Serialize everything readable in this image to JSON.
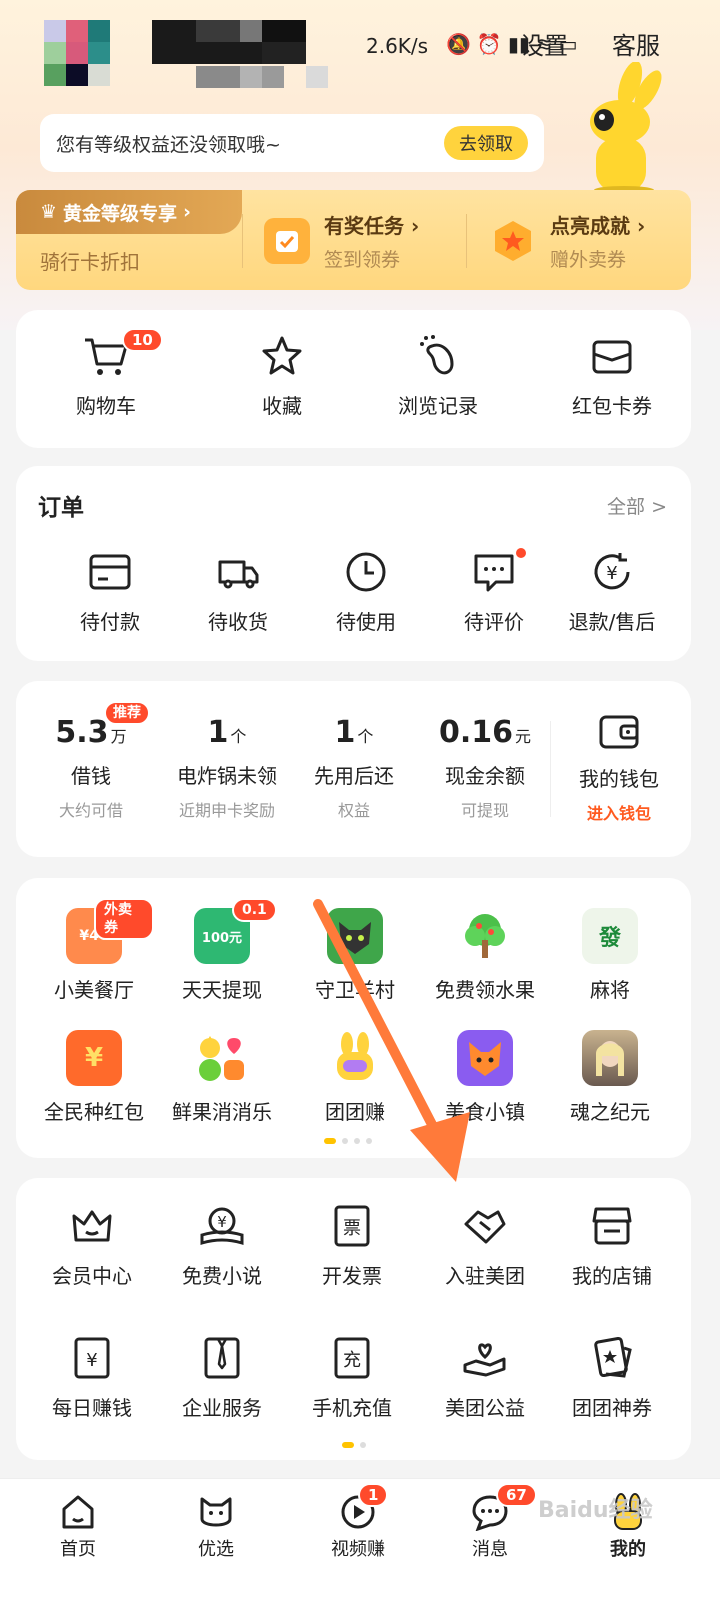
{
  "header": {
    "speed": "2.6K/s",
    "settings": "设置",
    "service": "客服"
  },
  "notice": {
    "text": "您有等级权益还没领取哦~",
    "button": "去领取"
  },
  "gold": {
    "tag": "黄金等级专享",
    "tag_sub": "骑行卡折扣",
    "items": [
      {
        "title": "有奖任务",
        "sub": "签到领券",
        "icon": "task-icon"
      },
      {
        "title": "点亮成就",
        "sub": "赠外卖券",
        "icon": "achievement-icon"
      }
    ]
  },
  "quick": [
    {
      "label": "购物车",
      "icon": "cart-icon",
      "badge": "10"
    },
    {
      "label": "收藏",
      "icon": "star-icon"
    },
    {
      "label": "浏览记录",
      "icon": "footprint-icon"
    },
    {
      "label": "红包卡券",
      "icon": "coupon-icon"
    }
  ],
  "orders": {
    "title": "订单",
    "more": "全部 >",
    "items": [
      {
        "label": "待付款",
        "icon": "card-icon"
      },
      {
        "label": "待收货",
        "icon": "truck-icon"
      },
      {
        "label": "待使用",
        "icon": "clock-icon"
      },
      {
        "label": "待评价",
        "icon": "comment-icon"
      },
      {
        "label": "退款/售后",
        "icon": "refund-icon"
      }
    ]
  },
  "finance": {
    "badge": "推荐",
    "items": [
      {
        "value": "5.3",
        "unit": "万",
        "label": "借钱",
        "sub": "大约可借"
      },
      {
        "value": "1",
        "unit": "个",
        "label": "电炸锅未领",
        "sub": "近期申卡奖励"
      },
      {
        "value": "1",
        "unit": "个",
        "label": "先用后还",
        "sub": "权益"
      },
      {
        "value": "0.16",
        "unit": "元",
        "label": "现金余额",
        "sub": "可提现"
      }
    ],
    "wallet": {
      "label": "我的钱包",
      "sub": "进入钱包",
      "icon": "wallet-icon"
    }
  },
  "games": {
    "row1": [
      {
        "label": "小美餐厅",
        "badge": "外卖券",
        "icon_text": "¥40",
        "color": "#ff8a4c"
      },
      {
        "label": "天天提现",
        "badge": "0.1",
        "icon_text": "100元",
        "color": "#2eb872"
      },
      {
        "label": "守卫羊村",
        "icon_text": "",
        "color": "#3fa64a"
      },
      {
        "label": "免费领水果",
        "icon_text": "",
        "color": "#4cc04a"
      },
      {
        "label": "麻将",
        "icon_text": "發",
        "color": "#e9f2e6"
      }
    ],
    "row2": [
      {
        "label": "全民种红包",
        "icon_text": "¥",
        "color": "#ff6a2b"
      },
      {
        "label": "鲜果消消乐",
        "icon_text": "",
        "color": "#ffb02e"
      },
      {
        "label": "团团赚",
        "icon_text": "",
        "color": "#ffd54a"
      },
      {
        "label": "美食小镇",
        "icon_text": "",
        "color": "#8a5cf0"
      },
      {
        "label": "魂之纪元",
        "icon_text": "",
        "color": "#8c7a6a"
      }
    ]
  },
  "services": {
    "row1": [
      {
        "label": "会员中心",
        "icon": "crown-icon"
      },
      {
        "label": "免费小说",
        "icon": "book-icon"
      },
      {
        "label": "开发票",
        "icon": "invoice-icon",
        "glyph": "票"
      },
      {
        "label": "入驻美团",
        "icon": "handshake-icon"
      },
      {
        "label": "我的店铺",
        "icon": "store-icon"
      }
    ],
    "row2": [
      {
        "label": "每日赚钱",
        "icon": "money-icon",
        "glyph": "¥"
      },
      {
        "label": "企业服务",
        "icon": "tie-icon"
      },
      {
        "label": "手机充值",
        "icon": "recharge-icon",
        "glyph": "充"
      },
      {
        "label": "美团公益",
        "icon": "charity-icon"
      },
      {
        "label": "团团神券",
        "icon": "voucher-icon"
      }
    ]
  },
  "tabs": [
    {
      "label": "首页",
      "icon": "home-icon"
    },
    {
      "label": "优选",
      "icon": "select-icon"
    },
    {
      "label": "视频赚",
      "icon": "video-icon",
      "badge": "1"
    },
    {
      "label": "消息",
      "icon": "message-icon",
      "badge": "67"
    },
    {
      "label": "我的",
      "icon": "mine-icon"
    }
  ],
  "colors": {
    "accent": "#ffc300",
    "badge": "#ff4a2b",
    "gold": "#ffd77e"
  },
  "watermark": "Baidu经验"
}
